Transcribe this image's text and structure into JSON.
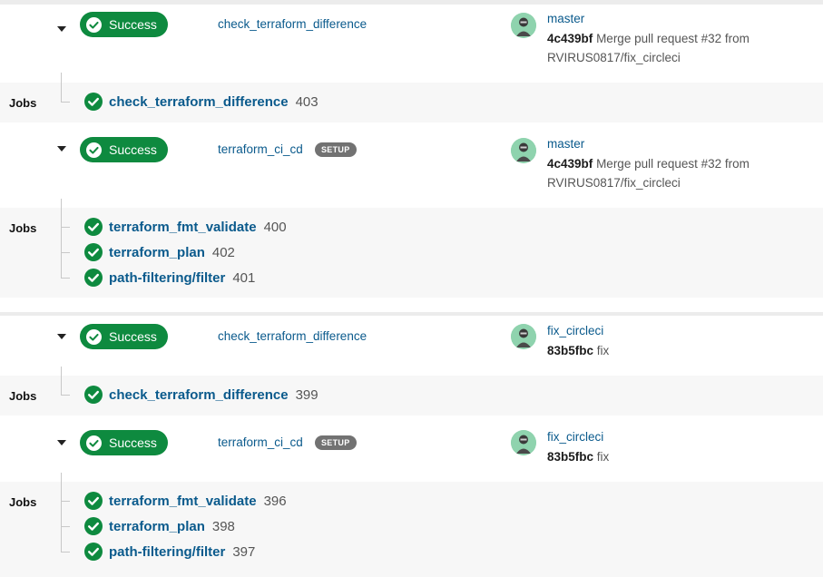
{
  "colors": {
    "success_green": "#0e8a3f",
    "link_blue": "#0a5a8c",
    "setup_gray": "#727272",
    "jobs_bg": "#f7f7f7",
    "avatar_bg": "#8fd3ae"
  },
  "icons": {
    "collapse": "chevron-down-icon",
    "status": "check-circle-icon",
    "user": "avatar-icon"
  },
  "jobs_label": "Jobs",
  "groups": [
    {
      "pipelines": [
        {
          "status": "Success",
          "workflow": "check_terraform_difference",
          "tag": "",
          "branch": "master",
          "commit_sha": "4c439bf",
          "commit_message": "Merge pull request #32 from RVIRUS0817/fix_circleci",
          "jobs": [
            {
              "name": "check_terraform_difference",
              "number": "403"
            }
          ]
        },
        {
          "status": "Success",
          "workflow": "terraform_ci_cd",
          "tag": "SETUP",
          "branch": "master",
          "commit_sha": "4c439bf",
          "commit_message": "Merge pull request #32 from RVIRUS0817/fix_circleci",
          "jobs": [
            {
              "name": "terraform_fmt_validate",
              "number": "400"
            },
            {
              "name": "terraform_plan",
              "number": "402"
            },
            {
              "name": "path-filtering/filter",
              "number": "401"
            }
          ]
        }
      ]
    },
    {
      "pipelines": [
        {
          "status": "Success",
          "workflow": "check_terraform_difference",
          "tag": "",
          "branch": "fix_circleci",
          "commit_sha": "83b5fbc",
          "commit_message": "fix",
          "jobs": [
            {
              "name": "check_terraform_difference",
              "number": "399"
            }
          ]
        },
        {
          "status": "Success",
          "workflow": "terraform_ci_cd",
          "tag": "SETUP",
          "branch": "fix_circleci",
          "commit_sha": "83b5fbc",
          "commit_message": "fix",
          "jobs": [
            {
              "name": "terraform_fmt_validate",
              "number": "396"
            },
            {
              "name": "terraform_plan",
              "number": "398"
            },
            {
              "name": "path-filtering/filter",
              "number": "397"
            }
          ]
        }
      ]
    }
  ]
}
